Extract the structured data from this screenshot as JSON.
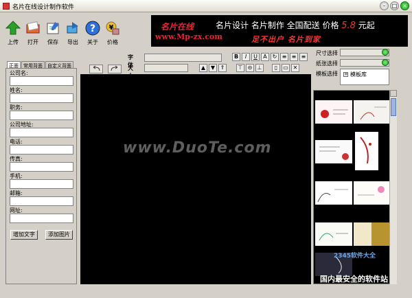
{
  "window": {
    "title": "名片在线设计制作软件"
  },
  "toolbar": {
    "buttons": [
      {
        "label": "上传",
        "icon": "upload-arrow-icon"
      },
      {
        "label": "打开",
        "icon": "open-book-icon"
      },
      {
        "label": "保存",
        "icon": "save-disk-icon"
      },
      {
        "label": "导出",
        "icon": "export-hand-icon"
      },
      {
        "label": "关于",
        "icon": "help-question-icon"
      },
      {
        "label": "价格",
        "icon": "price-tag-icon"
      }
    ]
  },
  "banner": {
    "logo_cn": "名片在线",
    "logo_url": "www.Mp-zx.com",
    "slogan": "名片设计  名片制作  全国配送  价格",
    "price": "5.8",
    "unit": "元起",
    "tagline": "足不出户  名片到家"
  },
  "left_panel": {
    "tabs": [
      "正面",
      "常用背面",
      "自定义背面"
    ],
    "fields": [
      {
        "label": "公司名:",
        "value": ""
      },
      {
        "label": "姓名:",
        "value": ""
      },
      {
        "label": "职务:",
        "value": ""
      },
      {
        "label": "公司地址:",
        "value": ""
      },
      {
        "label": "电话:",
        "value": ""
      },
      {
        "label": "传真:",
        "value": ""
      },
      {
        "label": "手机:",
        "value": ""
      },
      {
        "label": "邮箱:",
        "value": ""
      },
      {
        "label": "网址:",
        "value": ""
      }
    ],
    "add_text_button": "增加文字",
    "add_image_button": "添加图片"
  },
  "format_bar": {
    "font_label": "字体",
    "size_label": "大小",
    "font_value": "",
    "size_value": "",
    "style_buttons": [
      "B",
      "I",
      "U",
      "A"
    ]
  },
  "right_panel": {
    "size_label": "尺寸选择",
    "paper_label": "纸张选择",
    "template_label": "模板选择",
    "template_tree_item": "模板库"
  },
  "canvas": {
    "watermark": "www.DuoTe.com"
  },
  "watermarks": {
    "site1": "2345软件大全",
    "site2": "国内最安全的软件站"
  },
  "colors": {
    "accent_red": "#e22233",
    "canvas_bg": "#000000",
    "window_bg": "#d4d0c8"
  }
}
